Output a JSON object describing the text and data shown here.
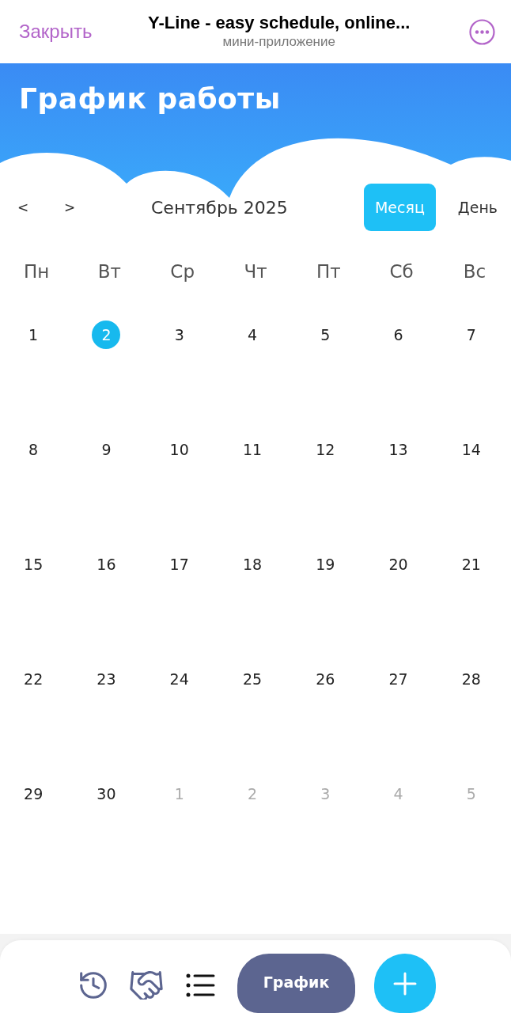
{
  "top_bar": {
    "close_label": "Закрыть",
    "title": "Y-Line - easy schedule, online...",
    "subtitle": "мини-приложение"
  },
  "header": {
    "title": "График работы"
  },
  "toolbar": {
    "prev": "<",
    "next": ">",
    "month_label": "Сентябрь 2025",
    "views": [
      {
        "label": "Месяц",
        "selected": true
      },
      {
        "label": "День",
        "selected": false
      }
    ]
  },
  "calendar": {
    "weekdays": [
      "Пн",
      "Вт",
      "Ср",
      "Чт",
      "Пт",
      "Сб",
      "Вс"
    ],
    "weeks": [
      [
        {
          "day": "1",
          "selected": false,
          "outside": false
        },
        {
          "day": "2",
          "selected": true,
          "outside": false
        },
        {
          "day": "3",
          "selected": false,
          "outside": false
        },
        {
          "day": "4",
          "selected": false,
          "outside": false
        },
        {
          "day": "5",
          "selected": false,
          "outside": false
        },
        {
          "day": "6",
          "selected": false,
          "outside": false
        },
        {
          "day": "7",
          "selected": false,
          "outside": false
        }
      ],
      [
        {
          "day": "8",
          "selected": false,
          "outside": false
        },
        {
          "day": "9",
          "selected": false,
          "outside": false
        },
        {
          "day": "10",
          "selected": false,
          "outside": false
        },
        {
          "day": "11",
          "selected": false,
          "outside": false
        },
        {
          "day": "12",
          "selected": false,
          "outside": false
        },
        {
          "day": "13",
          "selected": false,
          "outside": false
        },
        {
          "day": "14",
          "selected": false,
          "outside": false
        }
      ],
      [
        {
          "day": "15",
          "selected": false,
          "outside": false
        },
        {
          "day": "16",
          "selected": false,
          "outside": false
        },
        {
          "day": "17",
          "selected": false,
          "outside": false
        },
        {
          "day": "18",
          "selected": false,
          "outside": false
        },
        {
          "day": "19",
          "selected": false,
          "outside": false
        },
        {
          "day": "20",
          "selected": false,
          "outside": false
        },
        {
          "day": "21",
          "selected": false,
          "outside": false
        }
      ],
      [
        {
          "day": "22",
          "selected": false,
          "outside": false
        },
        {
          "day": "23",
          "selected": false,
          "outside": false
        },
        {
          "day": "24",
          "selected": false,
          "outside": false
        },
        {
          "day": "25",
          "selected": false,
          "outside": false
        },
        {
          "day": "26",
          "selected": false,
          "outside": false
        },
        {
          "day": "27",
          "selected": false,
          "outside": false
        },
        {
          "day": "28",
          "selected": false,
          "outside": false
        }
      ],
      [
        {
          "day": "29",
          "selected": false,
          "outside": false
        },
        {
          "day": "30",
          "selected": false,
          "outside": false
        },
        {
          "day": "1",
          "selected": false,
          "outside": true
        },
        {
          "day": "2",
          "selected": false,
          "outside": true
        },
        {
          "day": "3",
          "selected": false,
          "outside": true
        },
        {
          "day": "4",
          "selected": false,
          "outside": true
        },
        {
          "day": "5",
          "selected": false,
          "outside": true
        }
      ]
    ]
  },
  "bottom_nav": {
    "schedule_label": "График"
  }
}
